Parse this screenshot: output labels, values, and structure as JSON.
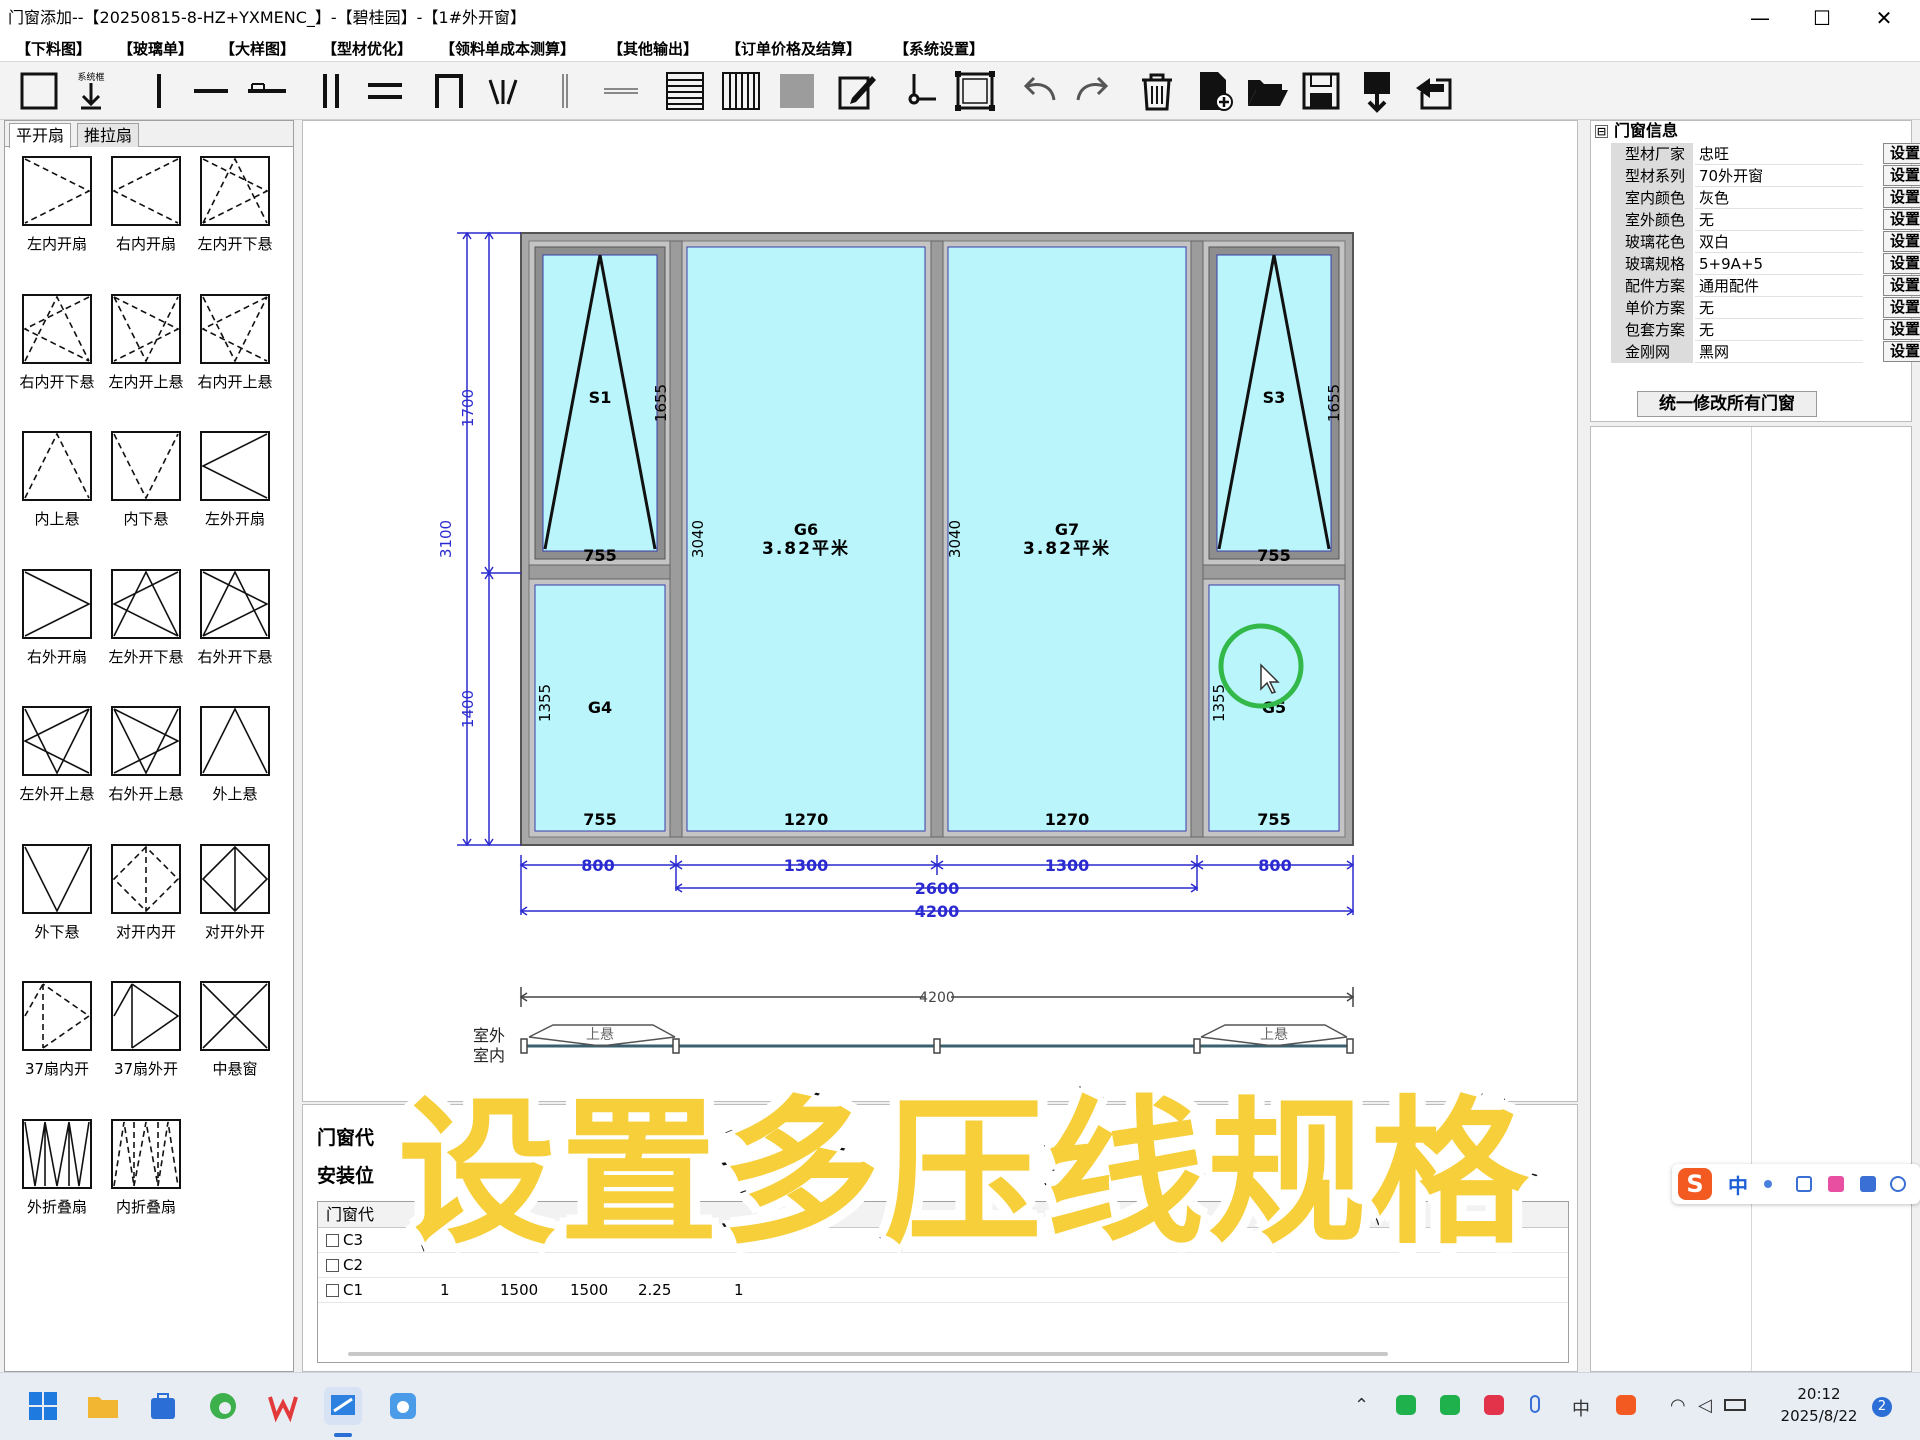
{
  "window": {
    "title": "门窗添加--【20250815-8-HZ+YXMENC_】-【碧桂园】-【1#外开窗】",
    "minimize": "—",
    "maximize": "☐",
    "close": "✕"
  },
  "menu": [
    "【下料图】",
    "【玻璃单】",
    "【大样图】",
    "【型材优化】",
    "【领料单成本测算】",
    "【其他输出】",
    "【订单价格及结算】",
    "【系统设置】"
  ],
  "toolbar": {
    "icons": [
      "frame-icon",
      "import-sash-icon",
      "vertical-mullion-icon",
      "horizontal-mullion-icon",
      "short-mullion-icon",
      "double-vertical-icon",
      "double-horizontal-icon",
      "door-frame-icon",
      "fan-split-icon",
      "thin-vertical-icon",
      "thin-horizontal-icon",
      "horizontal-panel-icon",
      "vertical-panel-icon",
      "solid-panel-icon",
      "edit-icon",
      "hardware-icon",
      "select-frame-icon",
      "undo-icon",
      "redo-icon",
      "trash-icon",
      "new-file-icon",
      "open-folder-icon",
      "save-icon",
      "export-icon",
      "exit-icon"
    ],
    "import_label": "系统框"
  },
  "left_panel": {
    "tabs": [
      "平开扇",
      "推拉扇"
    ],
    "sashes": [
      "左内开扇",
      "右内开扇",
      "左内开下悬",
      "右内开下悬",
      "左内开上悬",
      "右内开上悬",
      "内上悬",
      "内下悬",
      "左外开扇",
      "右外开扇",
      "左外开下悬",
      "右外开下悬",
      "左外开上悬",
      "右外开上悬",
      "外上悬",
      "外下悬",
      "对开内开",
      "对开外开",
      "37扇内开",
      "37扇外开",
      "中悬窗",
      "外折叠扇",
      "内折叠扇"
    ]
  },
  "drawing": {
    "colors": {
      "glass": "#b9f5fb",
      "frame": "#9a9a9a",
      "dimension": "#2a2ad0"
    },
    "panes": [
      {
        "name": "S1",
        "width": "755",
        "height": "1655"
      },
      {
        "name": "G4",
        "width": "755",
        "height": "1355"
      },
      {
        "name": "G6",
        "area": "3.82平米",
        "width": "1270",
        "height": "3040"
      },
      {
        "name": "G7",
        "area": "3.82平米",
        "width": "1270",
        "height": "3040"
      },
      {
        "name": "S3",
        "width": "755",
        "height": "1655"
      },
      {
        "name": "G5",
        "width": "755",
        "height": "1355"
      }
    ],
    "dims_bottom": [
      "800",
      "1300",
      "1300",
      "800"
    ],
    "dim_mid": "2600",
    "dim_total": "4200",
    "dims_left": [
      "1700",
      "3100",
      "1400"
    ],
    "section_total": "4200",
    "section_labels": {
      "outside": "室外",
      "inside": "室内",
      "top_hung": "上悬"
    }
  },
  "properties": {
    "heading": "门窗信息",
    "toggle": "⊟",
    "rows": [
      {
        "k": "型材厂家",
        "v": "忠旺"
      },
      {
        "k": "型材系列",
        "v": "70外开窗"
      },
      {
        "k": "室内颜色",
        "v": "灰色"
      },
      {
        "k": "室外颜色",
        "v": "无"
      },
      {
        "k": "玻璃花色",
        "v": "双白"
      },
      {
        "k": "玻璃规格",
        "v": "5+9A+5"
      },
      {
        "k": "配件方案",
        "v": "通用配件"
      },
      {
        "k": "单价方案",
        "v": "无"
      },
      {
        "k": "包套方案",
        "v": "无"
      },
      {
        "k": "金刚网",
        "v": "黑网"
      }
    ],
    "set_label": "设置",
    "apply_all": "统一修改所有门窗"
  },
  "bottom": {
    "code_label": "门窗代",
    "location_label": "安装位",
    "grid_header": "门窗代",
    "rows": [
      {
        "code": "C3",
        "cells": []
      },
      {
        "code": "C2",
        "cells": []
      },
      {
        "code": "C1",
        "cells": [
          "1",
          "1500",
          "1500",
          "2.25",
          "1"
        ]
      }
    ]
  },
  "caption": "设置多压线规格",
  "ime": {
    "logo": "S",
    "lang": "中"
  },
  "taskbar": {
    "apps": [
      "start-icon",
      "file-explorer-icon",
      "store-icon",
      "edge-icon",
      "wps-icon",
      "window-app-icon",
      "cloud-app-icon"
    ],
    "tray_lang": "中",
    "time": "20:12",
    "date": "2025/8/22",
    "badge": "2"
  }
}
